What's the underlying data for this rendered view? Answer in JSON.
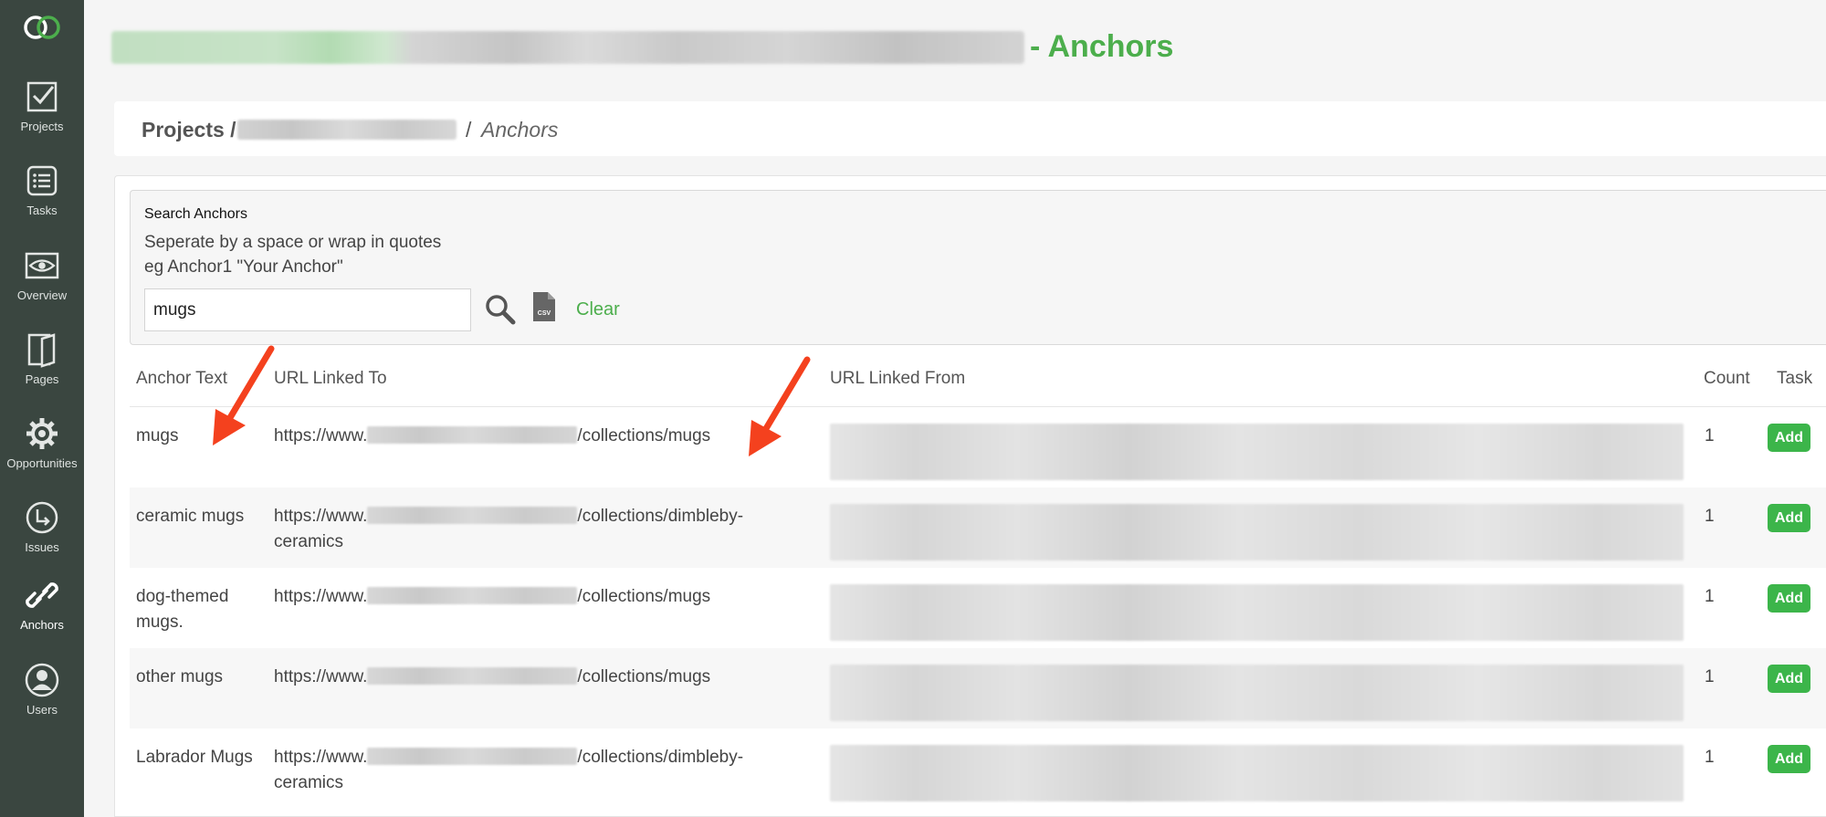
{
  "page": {
    "title": "- Anchors"
  },
  "sidebar": {
    "items": [
      {
        "label": "Projects",
        "icon": "check-square-icon"
      },
      {
        "label": "Tasks",
        "icon": "list-icon"
      },
      {
        "label": "Overview",
        "icon": "eye-icon"
      },
      {
        "label": "Pages",
        "icon": "pages-icon"
      },
      {
        "label": "Opportunities",
        "icon": "gear-icon"
      },
      {
        "label": "Issues",
        "icon": "arrow-circle-icon"
      },
      {
        "label": "Anchors",
        "icon": "link-icon",
        "active": true
      },
      {
        "label": "Users",
        "icon": "user-icon"
      }
    ]
  },
  "breadcrumb": {
    "projects": "Projects /",
    "separator": "/",
    "current": "Anchors"
  },
  "search": {
    "title": "Search Anchors",
    "hint_line1": "Seperate by a space or wrap in quotes",
    "hint_line2": "eg Anchor1 \"Your Anchor\"",
    "value": "mugs",
    "clear_label": "Clear"
  },
  "table": {
    "headers": {
      "anchor": "Anchor Text",
      "url_to": "URL Linked To",
      "url_from": "URL Linked From",
      "count": "Count",
      "task": "Task"
    },
    "rows": [
      {
        "anchor": "mugs",
        "url_prefix": "https://www.",
        "url_suffix": "/collections/mugs",
        "count": "1",
        "action": "Add"
      },
      {
        "anchor": "ceramic mugs",
        "url_prefix": "https://www.",
        "url_suffix": "/collections/dimbleby-ceramics",
        "count": "1",
        "action": "Add"
      },
      {
        "anchor": "dog-themed mugs.",
        "url_prefix": "https://www.",
        "url_suffix": "/collections/mugs",
        "count": "1",
        "action": "Add"
      },
      {
        "anchor": "other mugs",
        "url_prefix": "https://www.",
        "url_suffix": "/collections/mugs",
        "count": "1",
        "action": "Add"
      },
      {
        "anchor": "Labrador Mugs",
        "url_prefix": "https://www.",
        "url_suffix": "/collections/dimbleby-ceramics",
        "count": "1",
        "action": "Add"
      }
    ]
  },
  "colors": {
    "accent": "#4cae4c",
    "sidebar_bg": "#3a4640",
    "add_button": "#3cb54a",
    "annotation_arrow": "#f4411e"
  }
}
